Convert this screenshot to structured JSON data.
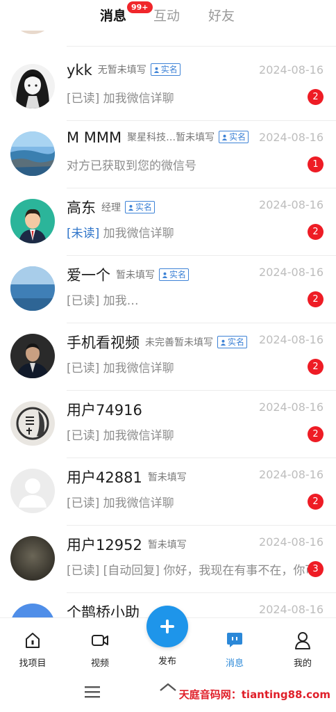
{
  "tabs": {
    "messages": "消息",
    "badge": "99+",
    "interaction": "互动",
    "friends": "好友"
  },
  "verify_label": "实名",
  "rows": [
    {
      "name": "ykk",
      "meta": "无暂未填写",
      "date": "2024-08-16",
      "read_tag": "[已读]",
      "preview": "加我微信详聊",
      "count": "2"
    },
    {
      "name": "M MMM",
      "meta": "聚星科技…暂未填写",
      "date": "2024-08-16",
      "read_tag": "",
      "preview": "对方已获取到您的微信号",
      "count": "1"
    },
    {
      "name": "高东",
      "meta": "经理",
      "date": "2024-08-16",
      "read_tag": "[未读]",
      "preview": "加我微信详聊",
      "count": "2"
    },
    {
      "name": "爱一个",
      "meta": "暂未填写",
      "date": "2024-08-16",
      "read_tag": "[已读]",
      "preview": "加我…",
      "count": "2"
    },
    {
      "name": "手机看视频",
      "meta": "未完善暂未填写",
      "date": "2024-08-16",
      "read_tag": "[已读]",
      "preview": "加我微信详聊",
      "count": "2"
    },
    {
      "name": "用户74916",
      "meta": "",
      "date": "2024-08-16",
      "read_tag": "[已读]",
      "preview": "加我微信详聊",
      "count": "2"
    },
    {
      "name": "用户42881",
      "meta": "暂未填写",
      "date": "2024-08-16",
      "read_tag": "[已读]",
      "preview": "加我微信详聊",
      "count": "2"
    },
    {
      "name": "用户12952",
      "meta": "暂未填写",
      "date": "2024-08-16",
      "read_tag": "[已读]",
      "preview": "[自动回复] 你好，我现在有事不在，你可",
      "count": "3"
    },
    {
      "name": "个鹊桥小助",
      "meta": "",
      "date": "2024-08-16",
      "read_tag": "",
      "preview": "",
      "count": ""
    }
  ],
  "nav": {
    "find_projects": "找项目",
    "video": "视频",
    "publish": "发布",
    "messages": "消息",
    "mine": "我的"
  },
  "watermark": "天庭音码网：tianting88.com",
  "colors": {
    "accent": "#1e95ea",
    "badge": "#ee1c25",
    "unread": "#2e74c9"
  }
}
